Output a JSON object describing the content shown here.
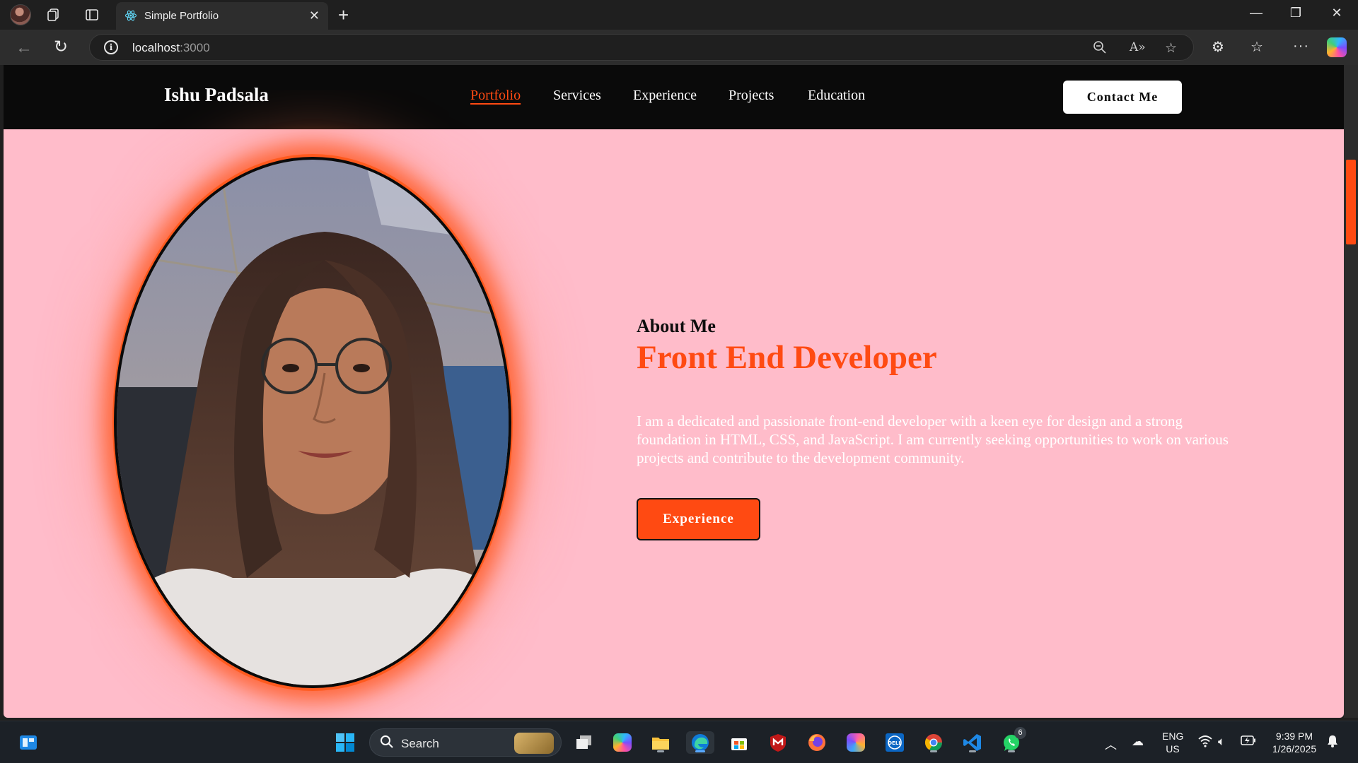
{
  "browser": {
    "tab_title": "Simple Portfolio",
    "url_host": "localhost",
    "url_port": ":3000"
  },
  "nav": {
    "brand": "Ishu Padsala",
    "links": [
      "Portfolio",
      "Services",
      "Experience",
      "Projects",
      "Education"
    ],
    "active_link": "Portfolio",
    "contact_label": "Contact Me"
  },
  "about": {
    "label": "About Me",
    "title": "Front End Developer",
    "description": "I am a dedicated and passionate front-end developer with a keen eye for design and a strong foundation in HTML, CSS, and JavaScript. I am currently seeking opportunities to work on various projects and contribute to the development community.",
    "button_label": "Experience"
  },
  "colors": {
    "accent": "#ff4a12",
    "page_background": "#ffbcca",
    "nav_background": "#0a0a0a"
  },
  "taskbar": {
    "search_label": "Search",
    "language": "ENG",
    "region": "US",
    "time": "9:39 PM",
    "date": "1/26/2025",
    "whatsapp_badge": "6"
  },
  "icons": {
    "browser": [
      "profile-avatar",
      "workspaces-icon",
      "vertical-tabs-icon",
      "react-favicon-icon",
      "close-icon",
      "plus-icon",
      "minimize-icon",
      "restore-icon",
      "window-close-icon",
      "back-icon",
      "refresh-icon",
      "site-info-icon",
      "zoom-icon",
      "read-aloud-icon",
      "favorite-star-icon",
      "extensions-icon",
      "favorites-icon",
      "more-icon",
      "copilot-icon"
    ],
    "taskbar": [
      "widgets-icon",
      "start-icon",
      "search-icon",
      "task-view-icon",
      "copilot-app-icon",
      "file-explorer-icon",
      "edge-icon",
      "store-icon",
      "mcafee-icon",
      "firefox-icon",
      "m365-icon",
      "dell-icon",
      "chrome-icon",
      "vscode-icon",
      "whatsapp-icon",
      "tray-chevron-icon",
      "onedrive-icon",
      "wifi-icon",
      "volume-icon",
      "battery-icon",
      "notification-bell-icon"
    ]
  }
}
